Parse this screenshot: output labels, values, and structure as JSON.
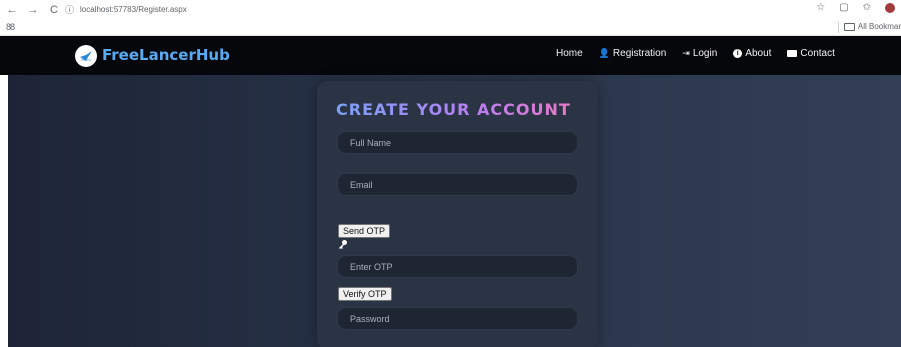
{
  "browser": {
    "back_icon": "←",
    "forward_icon": "→",
    "reload_icon": "C",
    "site_info_icon": "ⓘ",
    "url": "localhost:57783/Register.aspx",
    "apps_icon": "88",
    "bookmarks_label": "All Bookmar"
  },
  "site": {
    "brand": "FreeLancerHub",
    "nav": [
      {
        "label": "Home"
      },
      {
        "label": "Registration"
      },
      {
        "label": "Login"
      },
      {
        "label": "About"
      },
      {
        "label": "Contact"
      }
    ]
  },
  "form": {
    "title": "CREATE YOUR ACCOUNT",
    "full_name_placeholder": "Full Name",
    "email_placeholder": "Email",
    "send_otp_label": "Send OTP",
    "otp_placeholder": "Enter OTP",
    "verify_otp_label": "Verify OTP",
    "password_placeholder": "Password"
  },
  "colors": {
    "brand_blue": "#57aaf3",
    "nav_bg": "#05070b",
    "page_bg": "#283347",
    "card_bg": "#2b3445",
    "field_bg": "#1e2533"
  }
}
